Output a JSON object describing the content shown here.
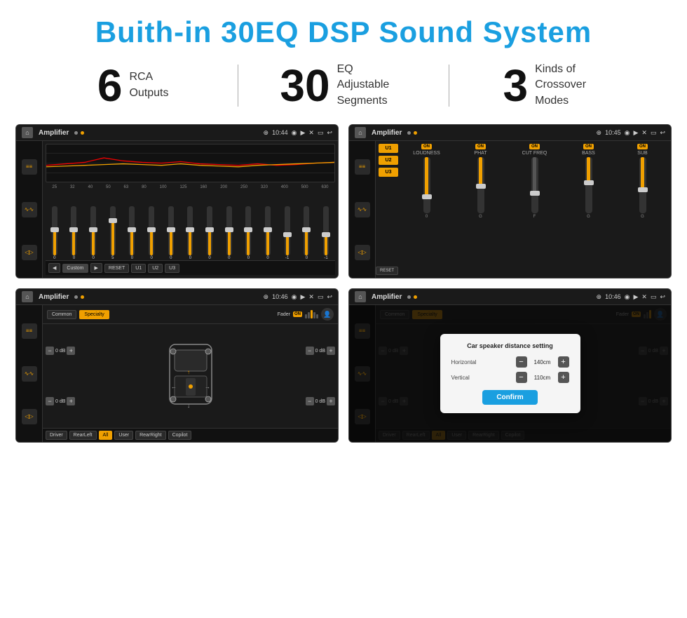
{
  "page": {
    "title": "Buith-in 30EQ DSP Sound System"
  },
  "stats": [
    {
      "id": "rca",
      "number": "6",
      "label": "RCA\nOutputs"
    },
    {
      "id": "eq",
      "number": "30",
      "label": "EQ Adjustable\nSegments"
    },
    {
      "id": "crossover",
      "number": "3",
      "label": "Kinds of\nCrossover Modes"
    }
  ],
  "screens": {
    "eq": {
      "title": "Amplifier",
      "time": "10:44",
      "freqs": [
        "25",
        "32",
        "40",
        "50",
        "63",
        "80",
        "100",
        "125",
        "160",
        "200",
        "250",
        "320",
        "400",
        "500",
        "630"
      ],
      "values": [
        "0",
        "0",
        "0",
        "5",
        "0",
        "0",
        "0",
        "0",
        "0",
        "0",
        "0",
        "0",
        "-1",
        "0",
        "-1"
      ],
      "sliderHeights": [
        50,
        50,
        50,
        65,
        50,
        50,
        50,
        50,
        50,
        50,
        50,
        50,
        38,
        50,
        38
      ],
      "preset": "Custom",
      "buttons": [
        "RESET",
        "U1",
        "U2",
        "U3"
      ]
    },
    "crossover": {
      "title": "Amplifier",
      "time": "10:45",
      "presets": [
        "U1",
        "U2",
        "U3"
      ],
      "channels": [
        {
          "label": "LOUDNESS",
          "on": true,
          "sliderHeight": 60
        },
        {
          "label": "PHAT",
          "on": true,
          "sliderHeight": 45
        },
        {
          "label": "CUT FREQ",
          "on": true,
          "sliderHeight": 55
        },
        {
          "label": "BASS",
          "on": true,
          "sliderHeight": 40
        },
        {
          "label": "SUB",
          "on": true,
          "sliderHeight": 50
        }
      ]
    },
    "speaker": {
      "title": "Amplifier",
      "time": "10:46",
      "tabs": [
        "Common",
        "Specialty"
      ],
      "fader": "Fader",
      "faderOn": "ON",
      "leftTopDb": "0 dB",
      "leftBotDb": "0 dB",
      "rightTopDb": "0 dB",
      "rightBotDb": "0 dB",
      "buttons": [
        "Driver",
        "RearLeft",
        "All",
        "User",
        "RearRight",
        "Copilot"
      ]
    },
    "distance": {
      "title": "Amplifier",
      "time": "10:46",
      "dialogTitle": "Car speaker distance setting",
      "horizontal_label": "Horizontal",
      "horizontal_value": "140cm",
      "vertical_label": "Vertical",
      "vertical_value": "110cm",
      "confirm_label": "Confirm",
      "rightTopDb": "0 dB",
      "rightBotDb": "0 dB"
    }
  },
  "icons": {
    "home": "⌂",
    "back": "↩",
    "settings": "⚙",
    "speaker": "♪",
    "eq": "≡",
    "pin": "⊕",
    "camera": "◉",
    "volume": "▶",
    "close": "✕",
    "window": "▭",
    "minus": "−",
    "plus": "+"
  },
  "colors": {
    "orange": "#f0a000",
    "blue": "#1a9fe0",
    "dark_bg": "#1a1a1a",
    "darker_bg": "#111111"
  }
}
